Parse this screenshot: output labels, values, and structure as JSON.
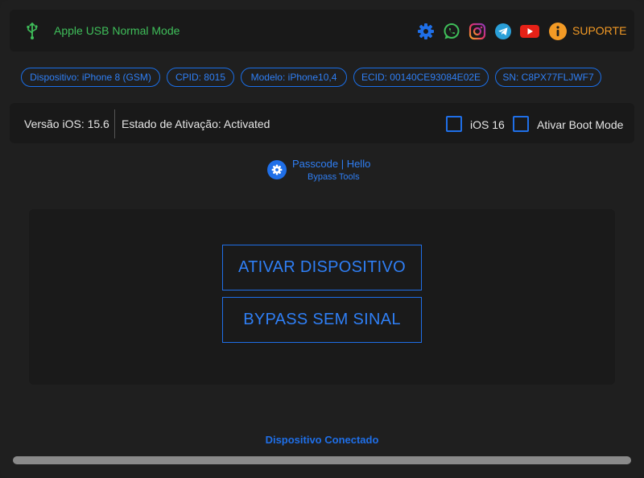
{
  "header": {
    "mode_text": "Apple USB Normal Mode",
    "icons": [
      "usb-icon",
      "gear-icon",
      "whatsapp-icon",
      "instagram-icon",
      "telegram-icon",
      "youtube-icon",
      "info-icon"
    ],
    "support_label": "SUPORTE"
  },
  "device_pills": [
    "Dispositivo: iPhone 8 (GSM)",
    "CPID: 8015",
    "Modelo: iPhone10,4",
    "ECID: 00140CE93084E02E",
    "SN: C8PX77FLJWF7"
  ],
  "info": {
    "ios_version": "Versão iOS: 15.6",
    "activation_state": "Estado de Ativação: Activated",
    "ios16_label": "iOS 16",
    "ios16_checked": false,
    "boot_mode_label": "Ativar Boot Mode",
    "boot_mode_checked": false
  },
  "tool": {
    "title": "Passcode | Hello",
    "subtitle": "Bypass Tools"
  },
  "actions": {
    "activate_label": "ATIVAR DISPOSITIVO",
    "bypass_label": "BYPASS SEM SINAL"
  },
  "status": "Dispositivo Conectado",
  "colors": {
    "accent": "#1f6fe8",
    "mode_green": "#3fbf5a",
    "support_orange": "#f39a25",
    "background": "#1f1f1f"
  }
}
